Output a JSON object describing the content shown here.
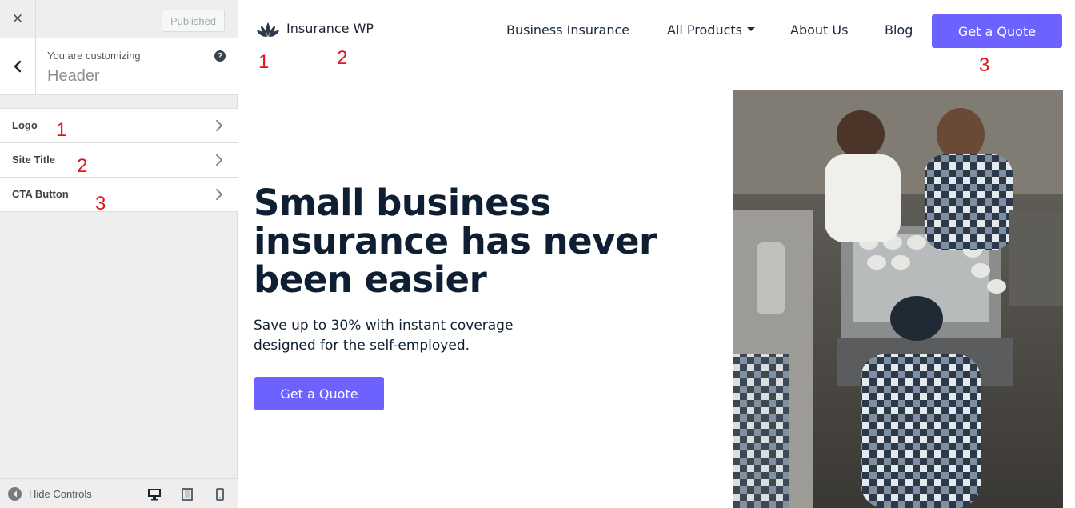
{
  "sidebar": {
    "close_icon": "close-icon",
    "publish_label": "Published",
    "customizing_label": "You are customizing",
    "section_title": "Header",
    "help_icon": "?",
    "items": [
      {
        "label": "Logo",
        "annotation": "1"
      },
      {
        "label": "Site Title",
        "annotation": "2"
      },
      {
        "label": "CTA Button",
        "annotation": "3"
      }
    ],
    "footer": {
      "hide_label": "Hide Controls",
      "devices": [
        "desktop-icon",
        "tablet-icon",
        "mobile-icon"
      ]
    }
  },
  "preview": {
    "site_title": "Insurance WP",
    "nav": [
      "Business Insurance",
      "All Products",
      "About Us",
      "Blog"
    ],
    "cta_label": "Get a Quote",
    "annotations": [
      "1",
      "2",
      "3"
    ],
    "hero": {
      "title": "Small business insurance has never been easier",
      "subtitle": "Save up to 30% with instant coverage designed for the self-employed.",
      "cta_label": "Get a Quote"
    }
  },
  "colors": {
    "accent": "#6c63ff",
    "annotation": "#e3131b",
    "heading": "#0f1f33"
  }
}
